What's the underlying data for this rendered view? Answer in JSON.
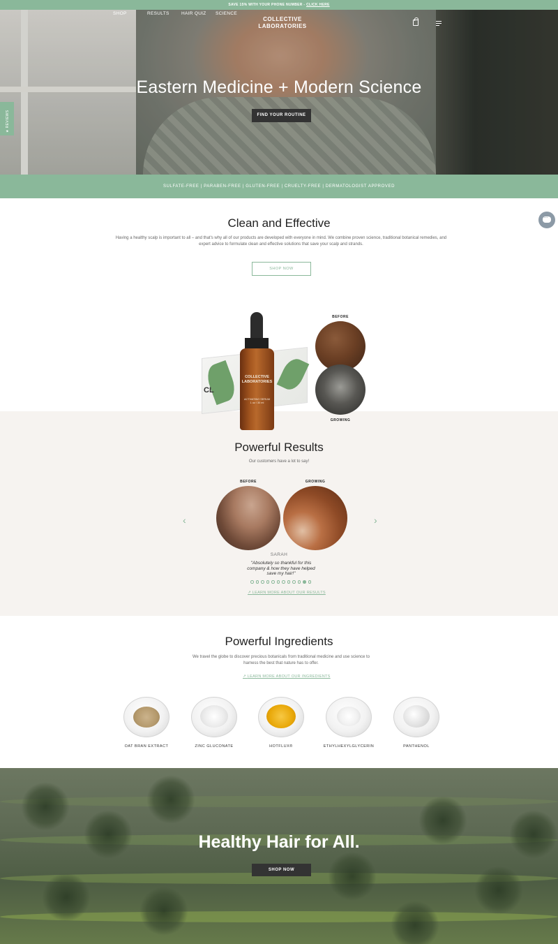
{
  "announcement": {
    "text": "SAVE 15% WITH YOUR PHONE NUMBER - ",
    "link": "CLICK HERE"
  },
  "nav": {
    "items": [
      "SHOP",
      "RESULTS",
      "HAIR QUIZ",
      "SCIENCE"
    ],
    "logo_line1": "COLLECTIVE",
    "logo_line2": "LABORATORIES",
    "icons": [
      "bag-icon",
      "menu-icon"
    ]
  },
  "hero": {
    "title": "Eastern Medicine + Modern Science",
    "button": "FIND YOUR ROUTINE"
  },
  "reviews_tab": "★ REVIEWS",
  "claims": "SULFATE-FREE | PARABEN-FREE | GLUTEN-FREE | CRUELTY-FREE | DERMATOLOGIST APPROVED",
  "clean": {
    "title": "Clean and Effective",
    "text": "Having a healthy scalp is important to all – and that's why all of our products are developed with everyone in mind. We combine proven science, traditional botanical remedies, and expert advice to formulate clean and effective solutions that save your scalp and strands.",
    "button": "SHOP NOW"
  },
  "product": {
    "box_mark": "CL",
    "bottle_line1": "COLLECTIVE",
    "bottle_line2": "LABORATORIES",
    "bottle_sub1": "ACTIVATING SERUM",
    "bottle_sub2": "1 oz / 30 ml",
    "before": "BEFORE",
    "after": "GROWING"
  },
  "results": {
    "title": "Powerful Results",
    "subtitle": "Our customers have a lot to say!",
    "before": "BEFORE",
    "after": "GROWING",
    "name": "SARAH",
    "quote": "\"Absolutely so thankful for this company & how they have helped save my hair!\"",
    "dot_count": 12,
    "active_dot": 10,
    "link": "LEARN MORE ABOUT OUR RESULTS"
  },
  "ingredients": {
    "title": "Powerful Ingredients",
    "text": "We travel the globe to discover precious botanicals from traditional medicine and use science to harness the best that nature has to offer.",
    "link": "LEARN MORE ABOUT OUR INGREDIENTS",
    "items": [
      "OAT BRAN EXTRACT",
      "ZINC GLUCONATE",
      "HOTFLUX®",
      "ETHYLHEXYLGLYCERIN",
      "PANTHENOL"
    ]
  },
  "footer_hero": {
    "title": "Healthy Hair for All.",
    "button": "SHOP NOW"
  },
  "colors": {
    "accent": "#8ab89a",
    "dark_button": "#333333",
    "results_bg": "#f6f3f0"
  }
}
